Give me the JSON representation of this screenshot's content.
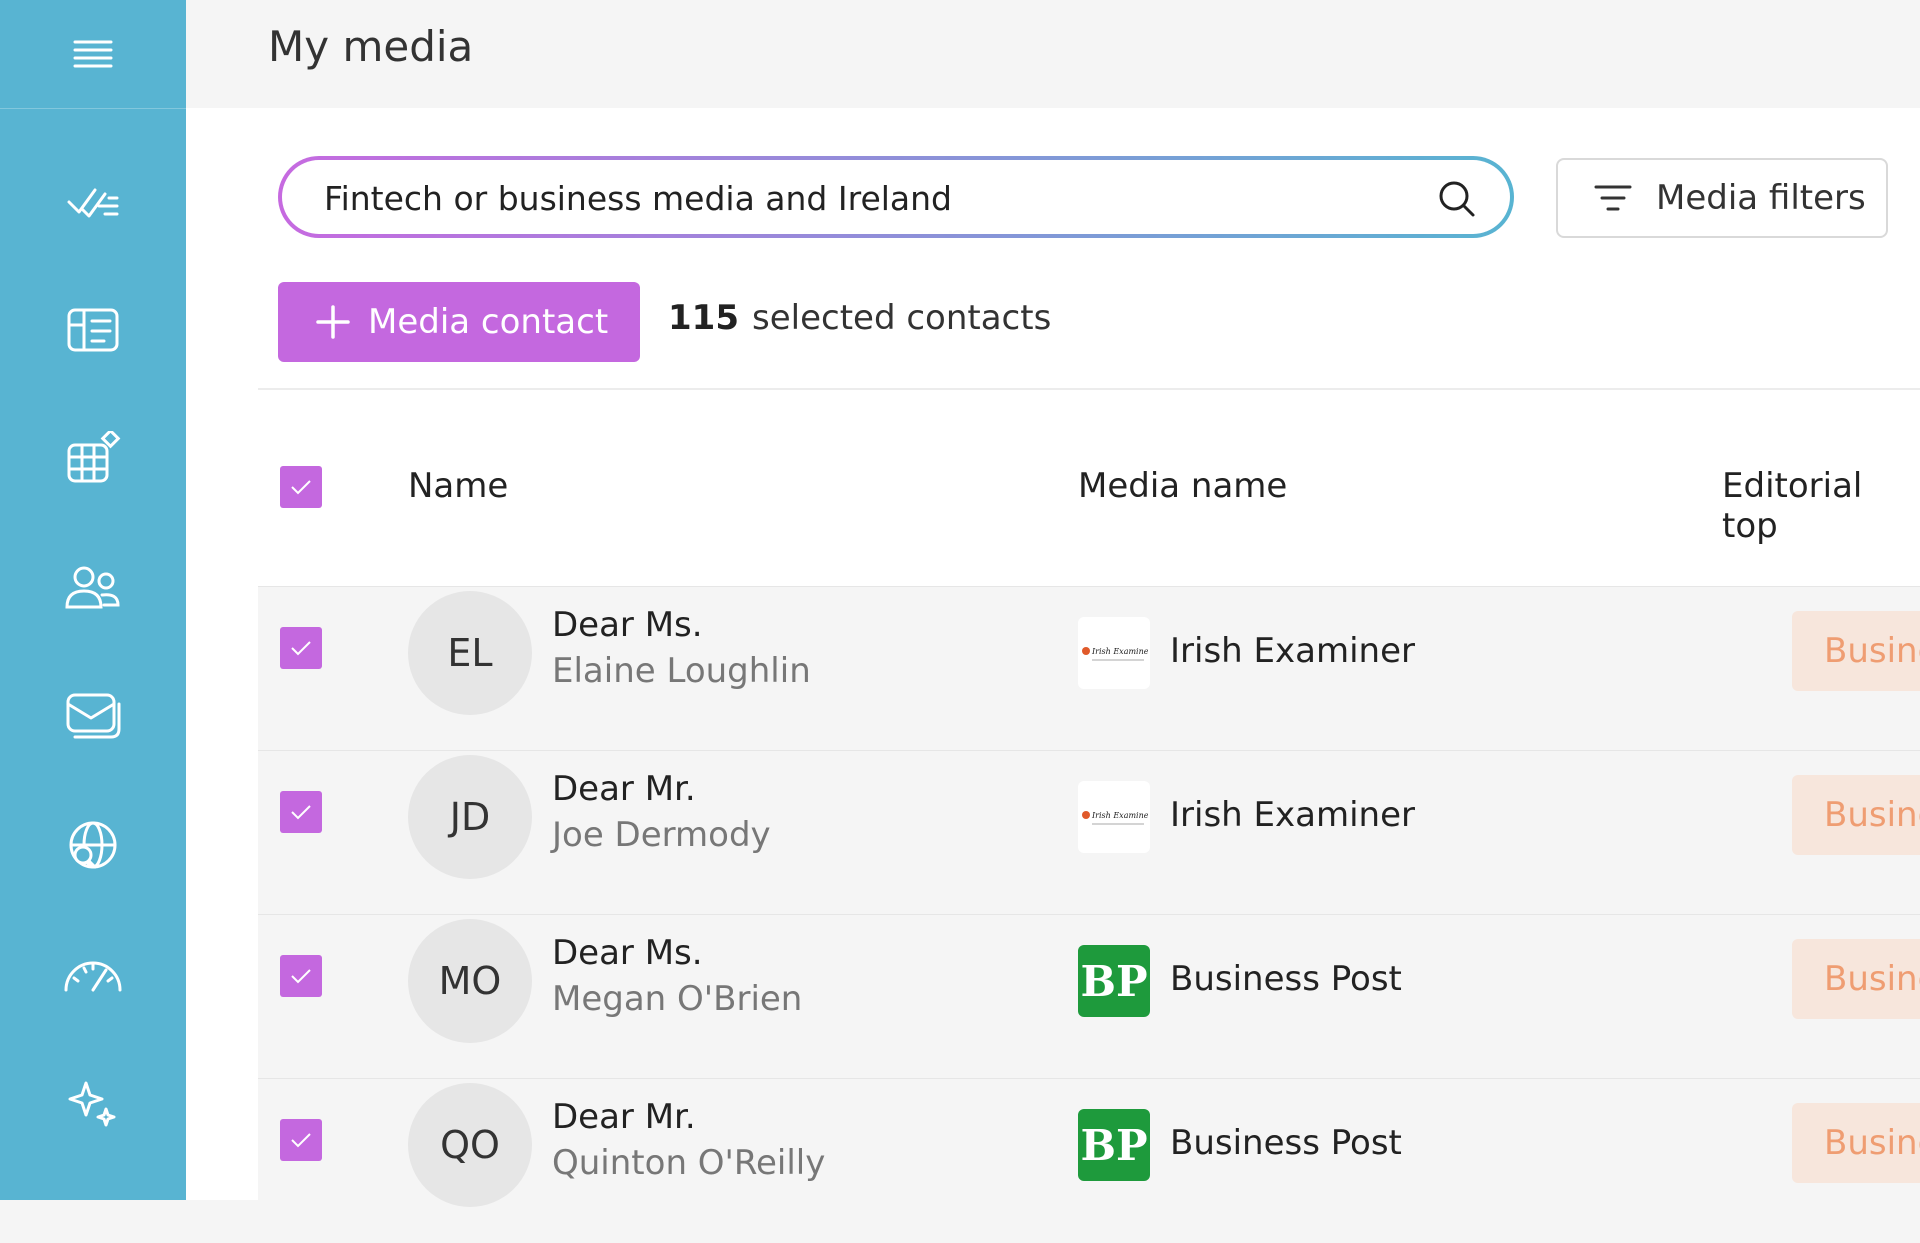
{
  "page": {
    "title": "My media"
  },
  "sidebar": {
    "icons": [
      "menu-icon",
      "tasks-icon",
      "dashboard-icon",
      "table-edit-icon",
      "contacts-icon",
      "mail-icon",
      "globe-search-icon",
      "gauge-icon",
      "sparkle-icon"
    ]
  },
  "search": {
    "value": "Fintech or business media and Ireland",
    "placeholder": ""
  },
  "filters": {
    "label": "Media filters"
  },
  "actions": {
    "add_label": "Media contact",
    "selected_count": "115",
    "selected_label": "selected contacts"
  },
  "table": {
    "headers": {
      "name": "Name",
      "media_name": "Media name",
      "editorial": "Editorial top"
    },
    "rows": [
      {
        "initials": "EL",
        "salutation": "Dear Ms.",
        "name": "Elaine Loughlin",
        "media": "Irish Examiner",
        "logo": "irish-examiner",
        "topic": "Business",
        "checked": true
      },
      {
        "initials": "JD",
        "salutation": "Dear Mr.",
        "name": "Joe Dermody",
        "media": "Irish Examiner",
        "logo": "irish-examiner",
        "topic": "Business",
        "checked": true
      },
      {
        "initials": "MO",
        "salutation": "Dear Ms.",
        "name": "Megan O'Brien",
        "media": "Business Post",
        "logo": "business-post",
        "topic": "Business",
        "checked": true
      },
      {
        "initials": "QO",
        "salutation": "Dear Mr.",
        "name": "Quinton O'Reilly",
        "media": "Business Post",
        "logo": "business-post",
        "topic": "Business",
        "checked": true
      }
    ]
  },
  "logos": {
    "business_post_text": "BP",
    "irish_examiner_text": "Irish Examiner"
  },
  "colors": {
    "sidebar": "#58b4d2",
    "accent": "#c468df",
    "topic_bg": "#f7e6dc",
    "topic_text": "#ef9d72"
  }
}
